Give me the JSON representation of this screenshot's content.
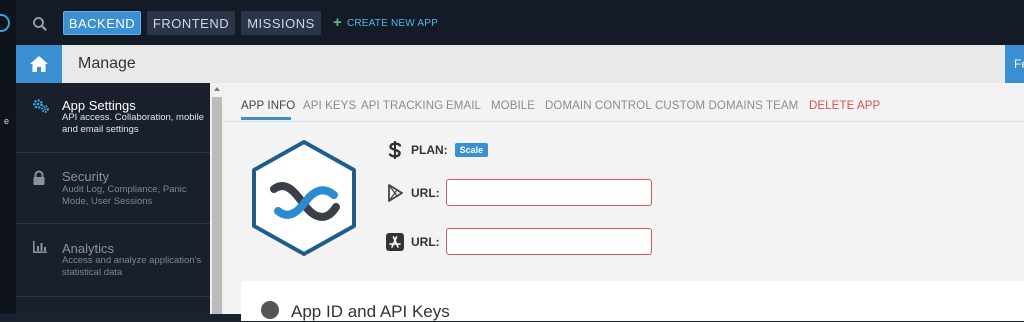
{
  "topbar": {
    "tabs": [
      {
        "label": "BACKEND",
        "active": true
      },
      {
        "label": "FRONTEND",
        "active": false
      },
      {
        "label": "MISSIONS",
        "active": false
      }
    ],
    "create_app_label": "CREATE NEW APP",
    "search_icon": "search-icon"
  },
  "rail": {
    "text": "e"
  },
  "manage_bar": {
    "title": "Manage",
    "home_icon": "home-icon",
    "right_stub_label": "Fe"
  },
  "side_menu": {
    "items": [
      {
        "title": "App Settings",
        "desc": "API access. Collaboration, mobile and email settings",
        "icon": "gears-icon",
        "active": true
      },
      {
        "title": "Security",
        "desc": "Audit Log, Compliance, Panic Mode, User Sessions",
        "icon": "lock-icon",
        "active": false
      },
      {
        "title": "Analytics",
        "desc": "Access and analyze application's statistical data",
        "icon": "bar-chart-icon",
        "active": false
      }
    ]
  },
  "main": {
    "tabs": [
      {
        "label": "APP INFO",
        "active": true
      },
      {
        "label": "API KEYS"
      },
      {
        "label": "API TRACKING"
      },
      {
        "label": "EMAIL"
      },
      {
        "label": "MOBILE"
      },
      {
        "label": "DOMAIN CONTROL"
      },
      {
        "label": "CUSTOM DOMAINS"
      },
      {
        "label": "TEAM"
      },
      {
        "label": "DELETE APP",
        "danger": true
      }
    ],
    "plan": {
      "label": "PLAN:",
      "value": "Scale",
      "icon": "dollar-icon"
    },
    "android_url": {
      "label": "URL:",
      "value": "",
      "icon": "google-play-icon"
    },
    "ios_url": {
      "label": "URL:",
      "value": "",
      "icon": "app-store-icon"
    },
    "card_title": "App ID and API Keys"
  },
  "colors": {
    "accent": "#3a8fd3",
    "danger": "#d9534f",
    "create_app": "#4fb7ea",
    "plus": "#3cc88a",
    "logo_ring": "#1d5f8c"
  }
}
